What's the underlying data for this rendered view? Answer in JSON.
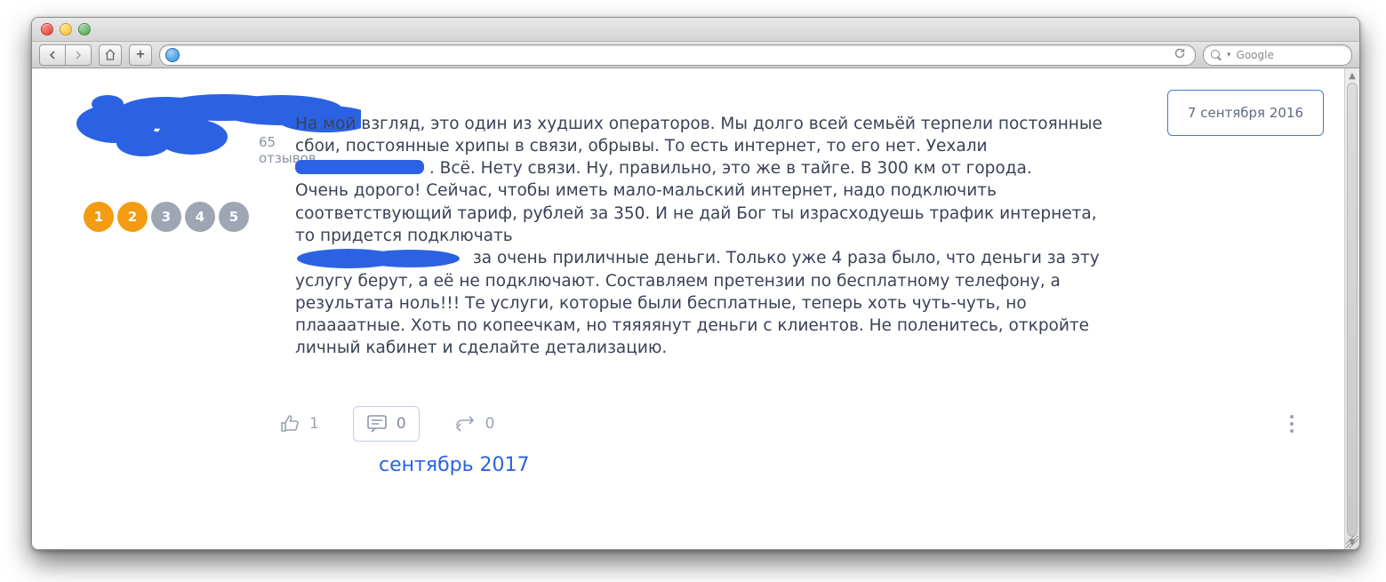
{
  "browser": {
    "search_placeholder": "Google"
  },
  "review": {
    "date_label": "7 сентября 2016",
    "reviews_count_label": "65 отзывов",
    "rating": {
      "value": 2,
      "scale": [
        1,
        2,
        3,
        4,
        5
      ]
    },
    "text_part1": "На мой взгляд, это один из худших операторов. Мы долго всей семьёй терпели постоянные сбои, постоянные хрипы в связи, обрывы. То есть интернет, то его нет. Уехали ",
    "text_part2": ". Всё. Нету связи. Ну, правильно, это же в тайге. В 300 км от города.",
    "text_part3": "Очень дорого! Сейчас, чтобы иметь мало-мальский интернет, надо подключить соответствующий тариф, рублей за 350. И не дай Бог ты израсходуешь трафик интернета, то придется подключать",
    "text_part4": "за очень приличные деньги. Только уже 4 раза было, что деньги за эту услугу берут, а её не подключают. Составляем претензии по бесплатному телефону, а результата ноль!!! Те услуги, которые были бесплатные, теперь хоть чуть-чуть, но плаааатные. Хоть по копеечкам, но тяяяянут деньги с клиентов. Не поленитесь, откройте личный кабинет и сделайте детализацию.",
    "likes": "1",
    "comments": "0",
    "shares": "0",
    "month_label": "сентябрь 2017"
  },
  "rating_labels": {
    "d1": "1",
    "d2": "2",
    "d3": "3",
    "d4": "4",
    "d5": "5"
  }
}
